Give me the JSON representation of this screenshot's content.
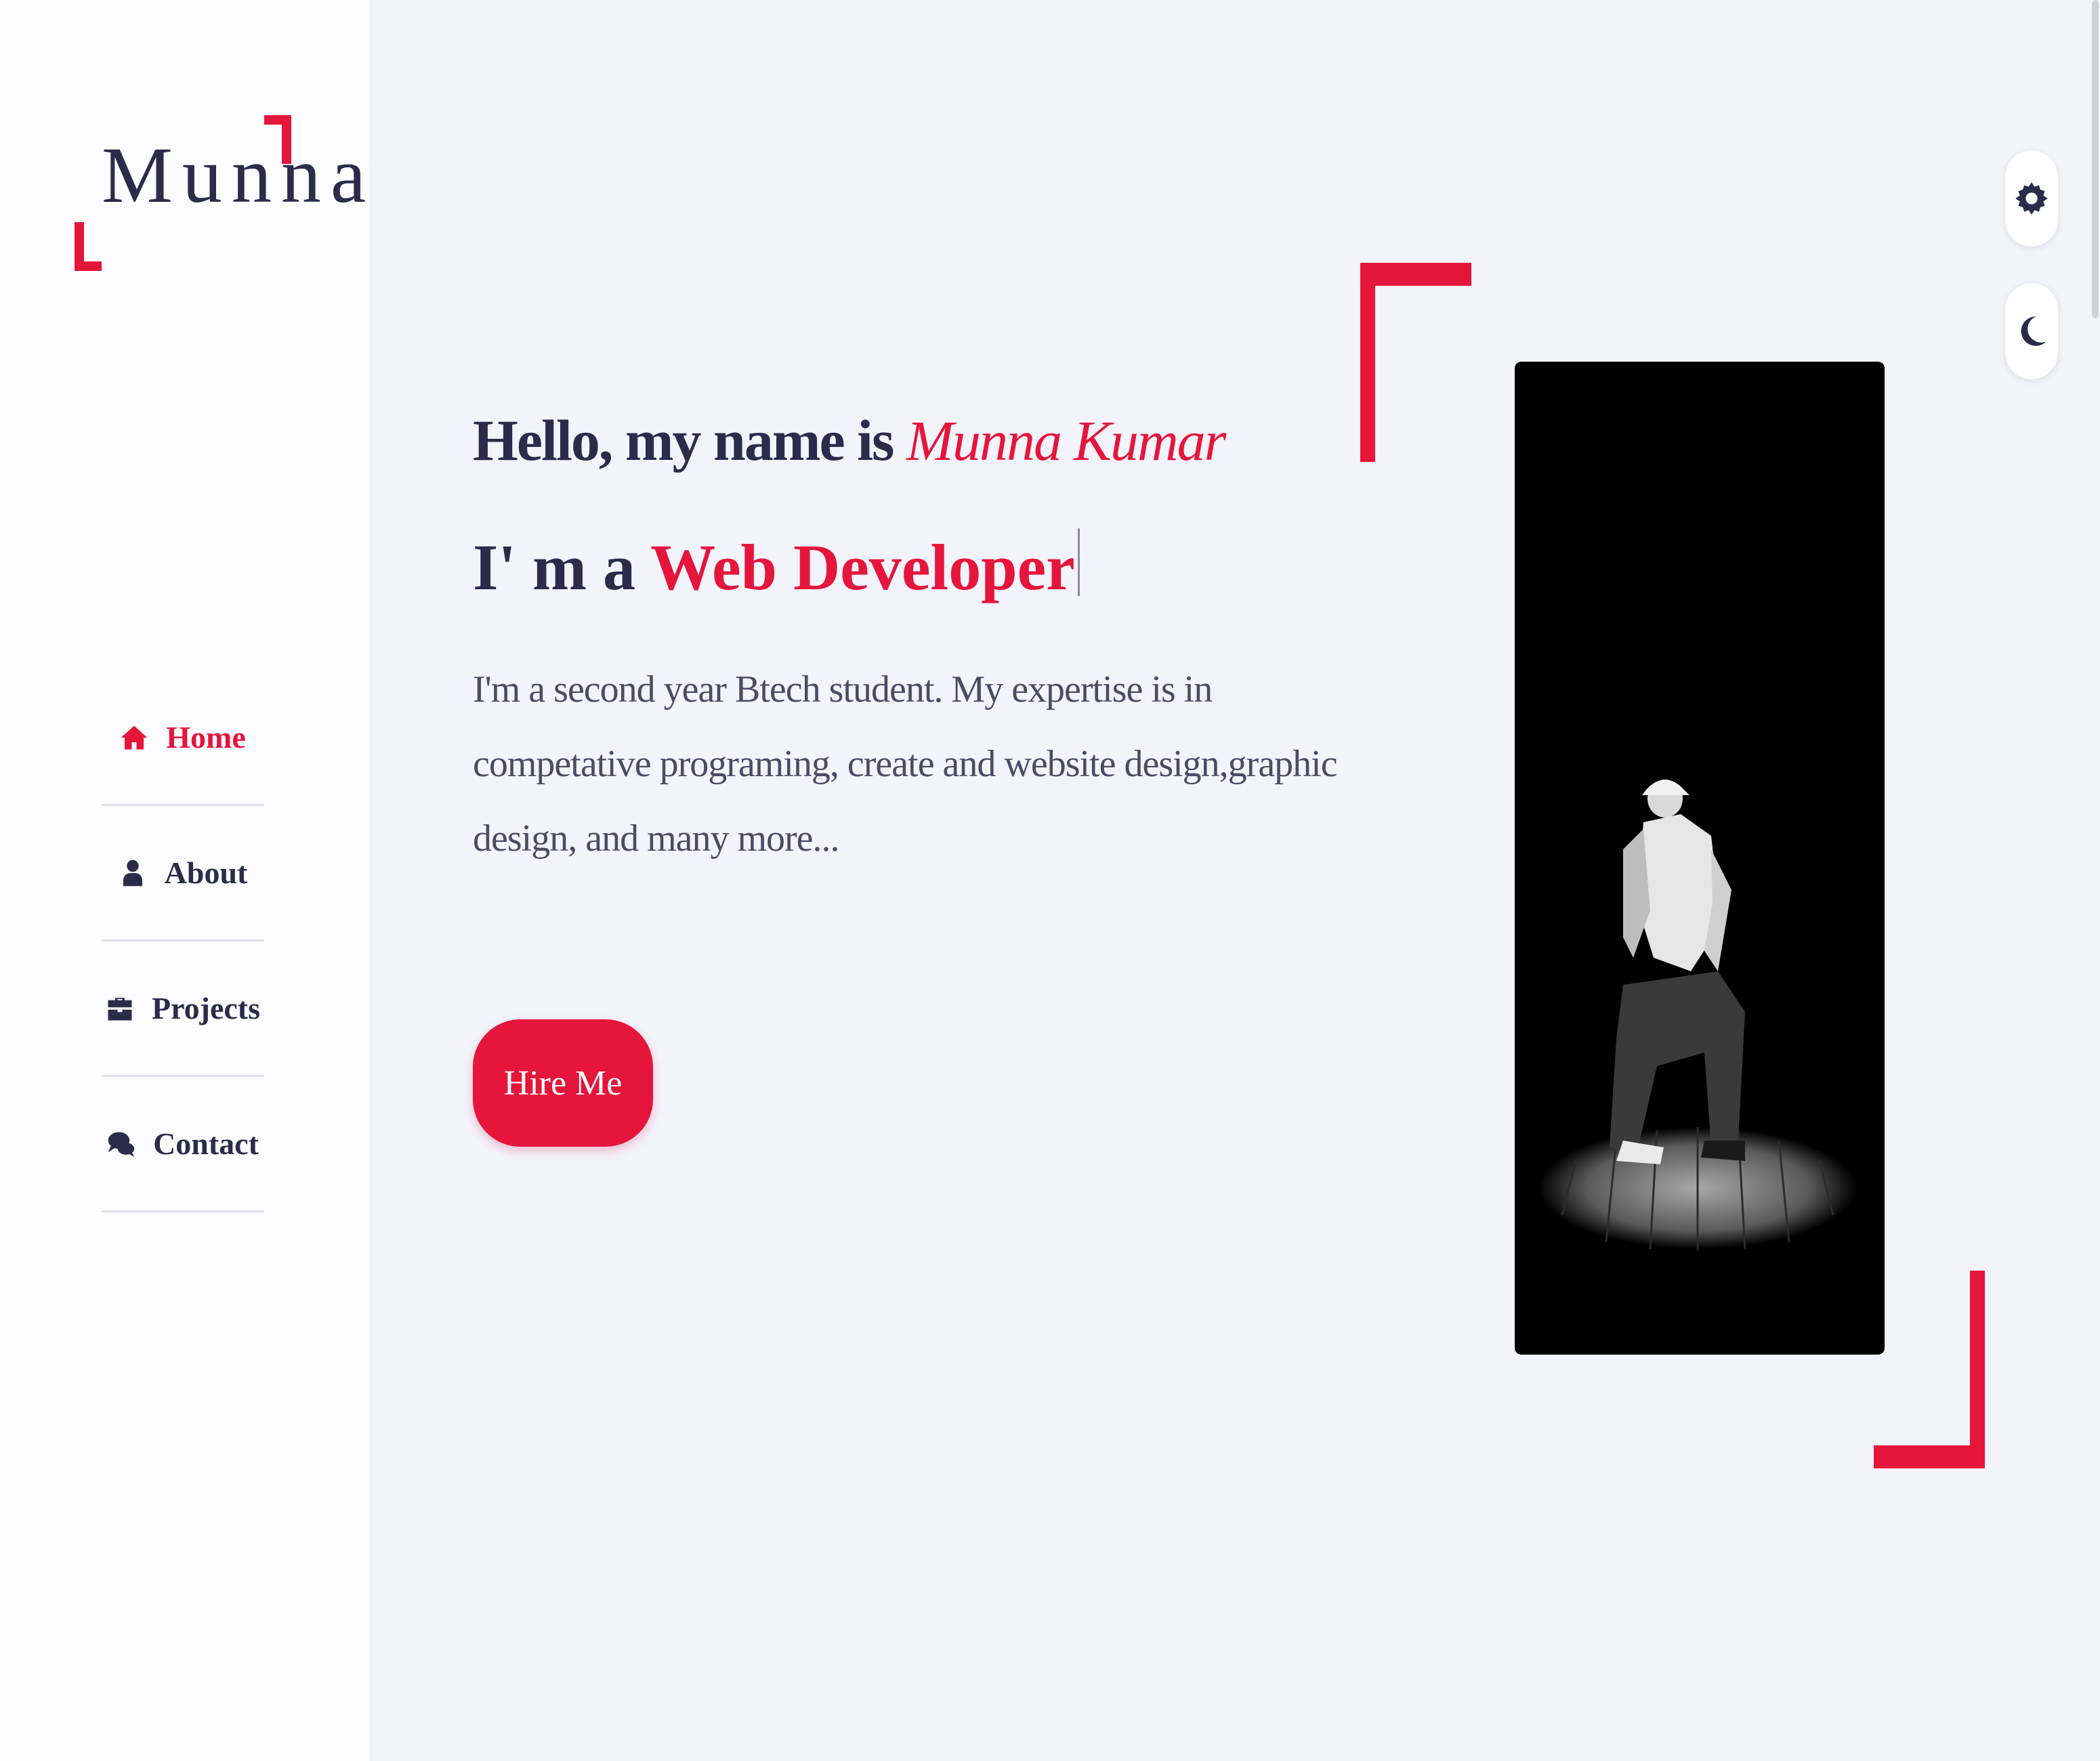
{
  "logo": {
    "text": "Munna"
  },
  "nav": {
    "items": [
      {
        "label": "Home",
        "icon": "home-icon",
        "active": true
      },
      {
        "label": "About",
        "icon": "user-icon",
        "active": false
      },
      {
        "label": "Projects",
        "icon": "briefcase-icon",
        "active": false
      },
      {
        "label": "Contact",
        "icon": "chat-icon",
        "active": false
      }
    ]
  },
  "hero": {
    "greeting": "Hello, my name is",
    "name": "Munna Kumar",
    "role_prefix": "I' m a",
    "role": "Web Developer",
    "bio": "I'm a second year Btech student. My expertise is in competative programing, create and website design,graphic design, and many more...",
    "cta_label": "Hire Me"
  },
  "controls": {
    "settings_icon": "gear-icon",
    "theme_icon": "moon-icon"
  },
  "colors": {
    "accent": "#e6153b",
    "text": "#2a2c4a",
    "background": "#f2f3fb",
    "sidebar": "#fcfbfe"
  }
}
